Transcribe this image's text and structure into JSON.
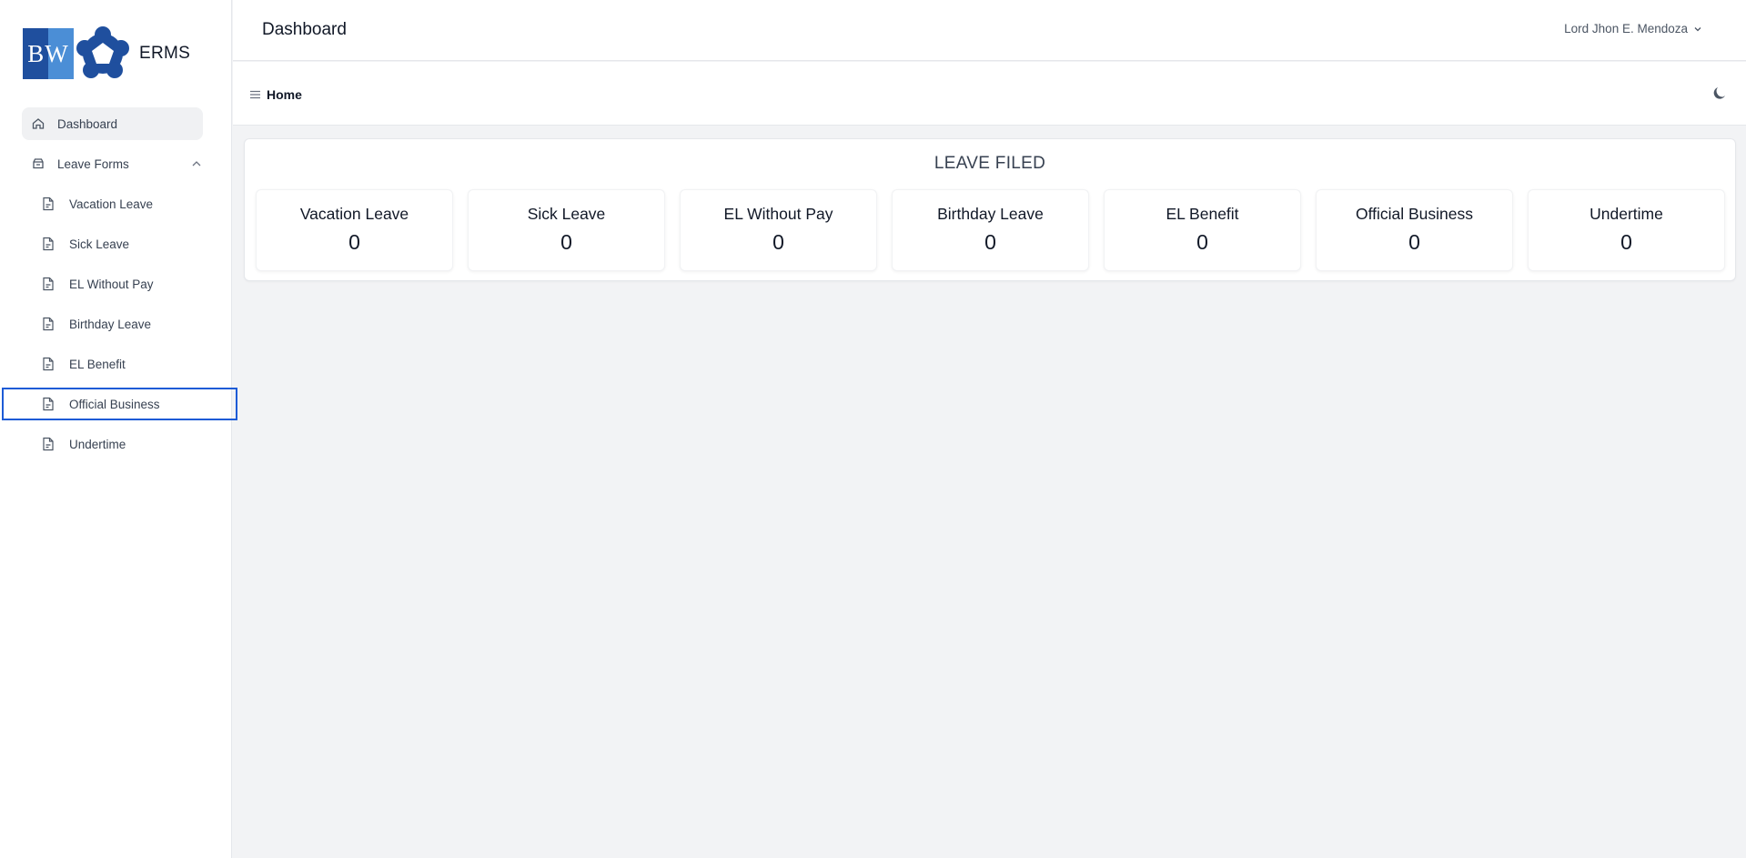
{
  "brand": {
    "logo_text": "BW",
    "app_name": "ERMS"
  },
  "sidebar": {
    "dashboard": "Dashboard",
    "leave_forms": "Leave Forms",
    "items": [
      {
        "label": "Vacation Leave",
        "name": "vacation-leave"
      },
      {
        "label": "Sick Leave",
        "name": "sick-leave"
      },
      {
        "label": "EL Without Pay",
        "name": "el-without-pay"
      },
      {
        "label": "Birthday Leave",
        "name": "birthday-leave"
      },
      {
        "label": "EL Benefit",
        "name": "el-benefit"
      },
      {
        "label": "Official Business",
        "name": "official-business"
      },
      {
        "label": "Undertime",
        "name": "undertime"
      }
    ]
  },
  "header": {
    "title": "Dashboard",
    "user": "Lord Jhon E. Mendoza"
  },
  "breadcrumb": {
    "home": "Home"
  },
  "leave_filed": {
    "title": "LEAVE FILED",
    "stats": [
      {
        "label": "Vacation Leave",
        "value": "0"
      },
      {
        "label": "Sick Leave",
        "value": "0"
      },
      {
        "label": "EL Without Pay",
        "value": "0"
      },
      {
        "label": "Birthday Leave",
        "value": "0"
      },
      {
        "label": "EL Benefit",
        "value": "0"
      },
      {
        "label": "Official Business",
        "value": "0"
      },
      {
        "label": "Undertime",
        "value": "0"
      }
    ]
  },
  "colors": {
    "accent": "#1d5bd6",
    "logo_blue": "#1f4f9e",
    "logo_light": "#4b8ed6"
  },
  "icons": [
    "home-icon",
    "inbox-icon",
    "chevron-up-icon",
    "file-icon",
    "chevron-down-icon",
    "menu-icon",
    "moon-icon"
  ]
}
